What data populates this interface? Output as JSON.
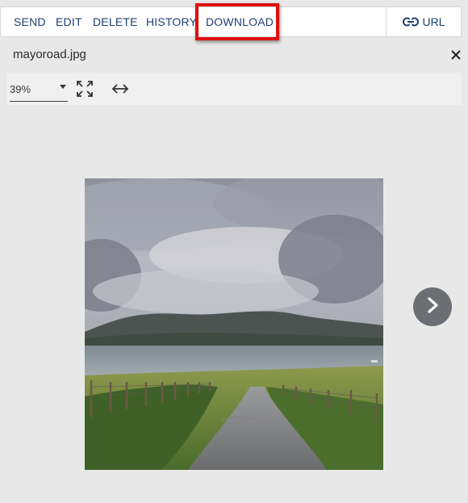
{
  "toolbar": {
    "send": "SEND",
    "edit": "EDIT",
    "delete": "DELETE",
    "history": "HISTORY",
    "download": "DOWNLOAD",
    "url": "URL",
    "url_icon": "link-icon"
  },
  "viewer": {
    "filename": "mayoroad.jpg",
    "close_icon": "close-icon",
    "zoom_value": "39%",
    "fullscreen_icon": "fullscreen-icon",
    "fit_width_icon": "fit-width-icon",
    "next_icon": "chevron-right-icon"
  },
  "colors": {
    "accent": "#1f3f73",
    "highlight": "#e01010",
    "background": "#e8e8e8",
    "next_button": "#6b6f74"
  }
}
